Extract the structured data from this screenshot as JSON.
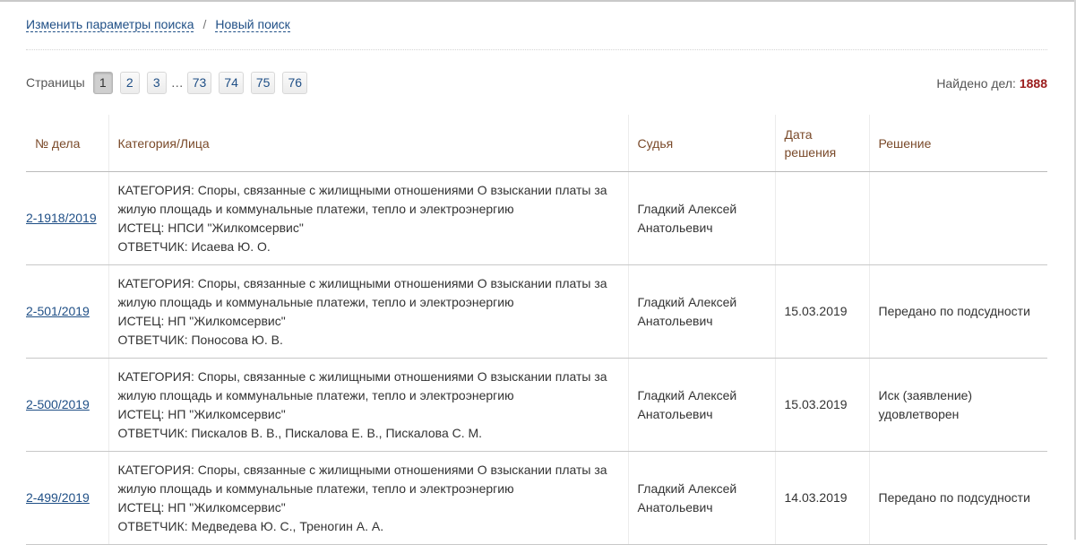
{
  "nav": {
    "modify_search": "Изменить параметры поиска",
    "separator": "/",
    "new_search": "Новый поиск"
  },
  "pager": {
    "label": "Страницы",
    "pages": [
      "1",
      "2",
      "3",
      "73",
      "74",
      "75",
      "76"
    ],
    "ellipsis": "…",
    "active_page": "1"
  },
  "found": {
    "label": "Найдено дел:",
    "count": "1888"
  },
  "table": {
    "headers": [
      "№ дела",
      "Категория/Лица",
      "Судья",
      "Дата решения",
      "Решение"
    ],
    "rows": [
      {
        "case": "2-1918/2019",
        "category": "КАТЕГОРИЯ: Споры, связанные с жилищными отношениями О взыскании платы за жилую площадь и коммунальные платежи, тепло и электроэнергию",
        "plaintiff": "ИСТЕЦ: НПСИ \"Жилкомсервис\"",
        "defendant": "ОТВЕТЧИК: Исаева Ю. О.",
        "judge": "Гладкий Алексей Анатольевич",
        "date": "",
        "decision": ""
      },
      {
        "case": "2-501/2019",
        "category": "КАТЕГОРИЯ: Споры, связанные с жилищными отношениями О взыскании платы за жилую площадь и коммунальные платежи, тепло и электроэнергию",
        "plaintiff": "ИСТЕЦ: НП \"Жилкомсервис\"",
        "defendant": "ОТВЕТЧИК: Поносова Ю. В.",
        "judge": "Гладкий Алексей Анатольевич",
        "date": "15.03.2019",
        "decision": "Передано по подсудности"
      },
      {
        "case": "2-500/2019",
        "category": "КАТЕГОРИЯ: Споры, связанные с жилищными отношениями О взыскании платы за жилую площадь и коммунальные платежи, тепло и электроэнергию",
        "plaintiff": "ИСТЕЦ: НП \"Жилкомсервис\"",
        "defendant": "ОТВЕТЧИК: Пискалов В. В., Пискалова Е. В., Пискалова С. М.",
        "judge": "Гладкий Алексей Анатольевич",
        "date": "15.03.2019",
        "decision": "Иск (заявление) удовлетворен"
      },
      {
        "case": "2-499/2019",
        "category": "КАТЕГОРИЯ: Споры, связанные с жилищными отношениями О взыскании платы за жилую площадь и коммунальные платежи, тепло и электроэнергию",
        "plaintiff": "ИСТЕЦ: НП \"Жилкомсервис\"",
        "defendant": "ОТВЕТЧИК: Медведева Ю. С., Треногин А. А.",
        "judge": "Гладкий Алексей Анатольевич",
        "date": "14.03.2019",
        "decision": "Передано по подсудности"
      }
    ]
  },
  "colors": {
    "link": "#1f4f86",
    "header_text": "#7a4a2a",
    "count": "#9b1c1c"
  }
}
